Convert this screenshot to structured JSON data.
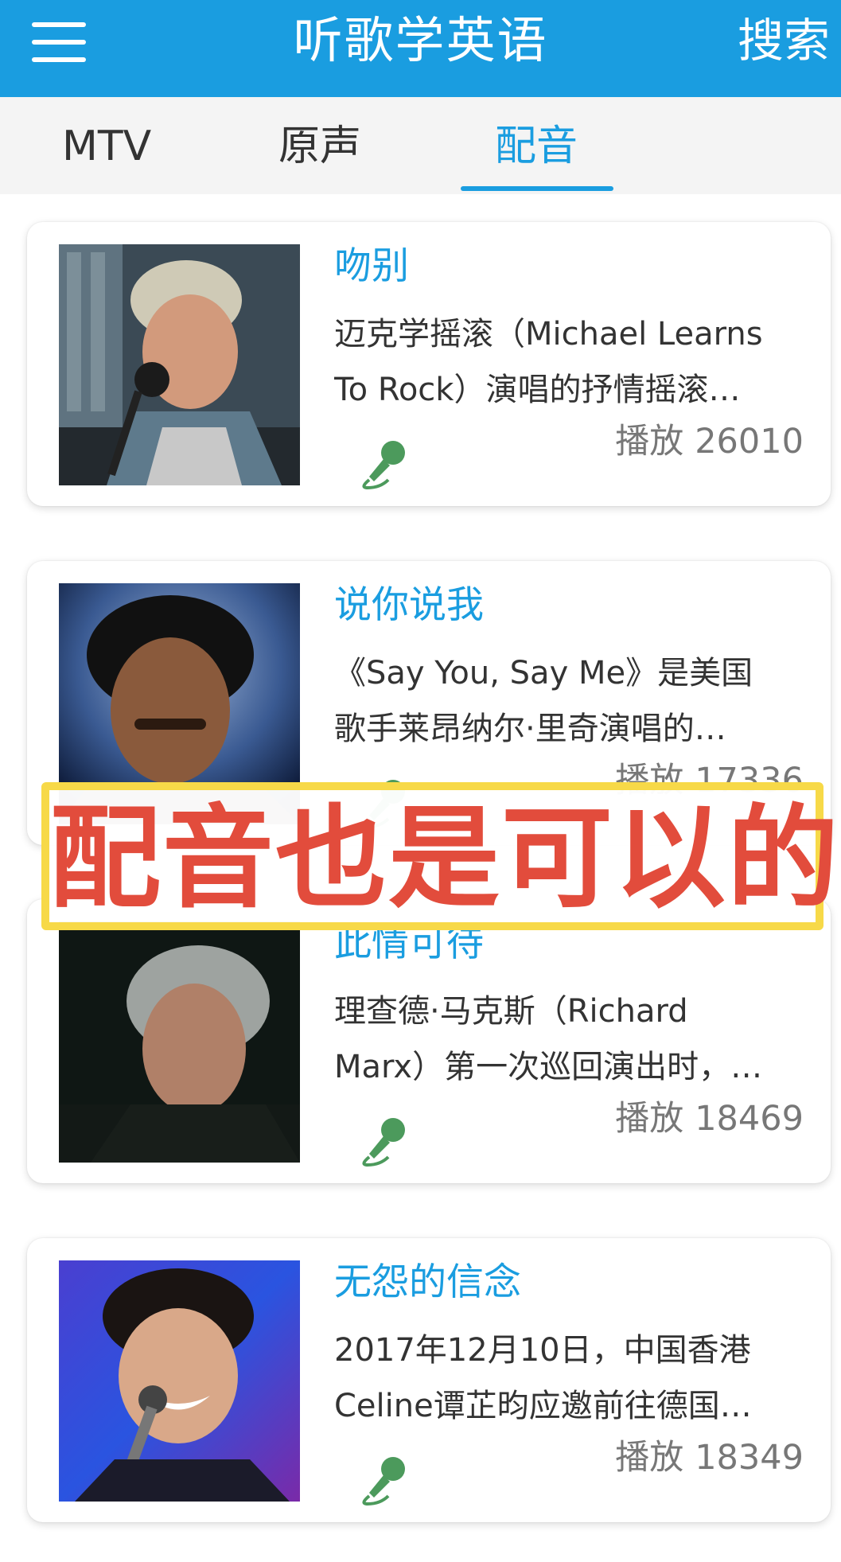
{
  "header": {
    "title": "听歌学英语",
    "search_label": "搜索",
    "menu_icon": "hamburger-menu-icon"
  },
  "tabs": [
    {
      "label": "MTV",
      "active": false
    },
    {
      "label": "原声",
      "active": false
    },
    {
      "label": "配音",
      "active": true
    }
  ],
  "songs": [
    {
      "title": "吻别",
      "desc_line1": "迈克学摇滚（Michael Learns",
      "desc_line2": "To Rock）演唱的抒情摇滚…",
      "plays_label": "播放",
      "plays": "26010",
      "action_icon": "microphone-icon"
    },
    {
      "title": "说你说我",
      "desc_line1": "《Say You, Say Me》是美国",
      "desc_line2": "歌手莱昂纳尔·里奇演唱的…",
      "plays_label": "播放",
      "plays": "17336",
      "action_icon": "microphone-icon"
    },
    {
      "title": "此情可待",
      "desc_line1": "理查德·马克斯（Richard",
      "desc_line2": "Marx）第一次巡回演出时，…",
      "plays_label": "播放",
      "plays": "18469",
      "action_icon": "microphone-icon"
    },
    {
      "title": "无怨的信念",
      "desc_line1": "2017年12月10日，中国香港",
      "desc_line2": "Celine谭芷昀应邀前往德国…",
      "plays_label": "播放",
      "plays": "18349",
      "action_icon": "microphone-icon"
    }
  ],
  "overlay_caption": "配音也是可以的",
  "colors": {
    "accent": "#1a9de0",
    "mic_green": "#4c9a5c",
    "caption_red": "#e24c3c",
    "caption_border": "#f7d948"
  }
}
